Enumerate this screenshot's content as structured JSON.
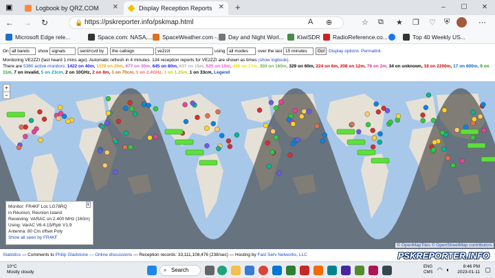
{
  "browser": {
    "tabs": [
      {
        "label": "Logbook by QRZ.COM",
        "icon": "qrz-favicon",
        "active": false
      },
      {
        "label": "Display Reception Reports",
        "icon": "pskreporter-favicon",
        "active": true
      }
    ],
    "new_tab": "+",
    "window_buttons": [
      "–",
      "☐",
      "✕"
    ],
    "url": "https://pskreporter.info/pskmap.html",
    "favorites": [
      "Microsoft Edge rele...",
      "Space.com: NASA,...",
      "SpaceWeather.com -...",
      "Day and Night Worl...",
      "KiwiSDR",
      "RadioReference.co...",
      "Top 40 Weekly US..."
    ]
  },
  "controls": {
    "on_label": "On",
    "band": "all bands",
    "show_label": "show",
    "signals": "signals",
    "direction": "sent/rcvd by",
    "callsign_mode": "the callsign",
    "callsign": "ve2zzi",
    "using_label": "using",
    "mode": "all modes",
    "over_label": "over the last",
    "period": "15 minutes",
    "go": "Go!",
    "display_options": "Display options",
    "permalink": "Permalink"
  },
  "status": {
    "monitoring": "Monitoring VE2ZZI (last heard 1 mins ago). Automatic refresh in 4 minutes. 134 reception reports for VE2ZZI are shown as times",
    "show_logbook": "(show logbook).",
    "there_are": "There are",
    "active_monitors": "5380 active monitors:",
    "bands_line1": [
      {
        "text": "1422 on 40m,",
        "color": "#1a1aff"
      },
      {
        "text": "1170 on 20m,",
        "color": "#e6a800"
      },
      {
        "text": "677 on 30m,",
        "color": "#d060d0"
      },
      {
        "text": "645 on 80m,",
        "color": "#1a1aff"
      },
      {
        "text": "637 on 15m,",
        "color": "#b0b0b0"
      },
      {
        "text": "525 on 10m,",
        "color": "#ff4dd2"
      },
      {
        "text": "446 on 17m,",
        "color": "#e6e600"
      },
      {
        "text": "350 on 160m,",
        "color": "#6ab04c"
      },
      {
        "text": "329 on 60m,",
        "color": "#000000"
      },
      {
        "text": "224 on 6m,",
        "color": "#cc0000"
      },
      {
        "text": "208 on 12m,",
        "color": "#cc0000"
      },
      {
        "text": "78 on 2m,",
        "color": "#cc3399"
      },
      {
        "text": "34 on unknown,",
        "color": "#000000"
      },
      {
        "text": "18 on 2200m,",
        "color": "#cc0000"
      },
      {
        "text": "17 on 600m,",
        "color": "#0066cc"
      },
      {
        "text": "9 on",
        "color": "#1a9f1a"
      }
    ],
    "bands_line2": [
      {
        "text": "11m,",
        "color": "#1a9f1a"
      },
      {
        "text": "7 on invalid,",
        "color": "#000000"
      },
      {
        "text": "5 on 23cm,",
        "color": "#00aaaa"
      },
      {
        "text": "2 on 10GHz,",
        "color": "#000000"
      },
      {
        "text": "2 on 8m,",
        "color": "#cc0000"
      },
      {
        "text": "1 on 70cm,",
        "color": "#cc6600"
      },
      {
        "text": "1 on 2.4GHz,",
        "color": "#ff6666"
      },
      {
        "text": "1 on 1.25m,",
        "color": "#cccc00"
      },
      {
        "text": "1 on 33cm,",
        "color": "#000000"
      },
      {
        "text": "Legend",
        "color": "#1a4bbd"
      }
    ]
  },
  "map": {
    "zoom_in": "+",
    "zoom_out": "−",
    "popup": {
      "close": "x",
      "monitor": "Monitor: FR4KF Loc LG78RQ",
      "location": "in Réunion, Reunion Island",
      "receiving": "Receiving: VARAC on 2.400 MHz (160m)",
      "using": "Using: VarAC V6.4.15/Rptr V1.9",
      "antenna": "Antenna: 80 Cm offset Poly",
      "show_all": "Show all seen by FR4KF"
    },
    "attribution_a": "© OpenMapTiles",
    "attribution_b": "© OpenStreetMap contributors",
    "colors": {
      "ocean": "#a8c8ea",
      "land": "#e6e1d6",
      "night": "#4a4a48"
    }
  },
  "footer": {
    "statistics": "Statistics",
    "comments": "— Comments to",
    "author": "Philip Gladstone",
    "online": "— Online discussions",
    "records": "— Reception records: 33,111,108,476 (238/sec)",
    "hosting": "— Hosting by",
    "host": "Fast Serv Networks, LLC",
    "watermark": "PSKREPORTER.INFO"
  },
  "taskbar": {
    "temp": "10°C",
    "weather": "Mostly cloudy",
    "search": "Search",
    "lang1": "ENG",
    "lang2": "CMS",
    "time": "8:46 PM",
    "date": "2023-01-11"
  }
}
